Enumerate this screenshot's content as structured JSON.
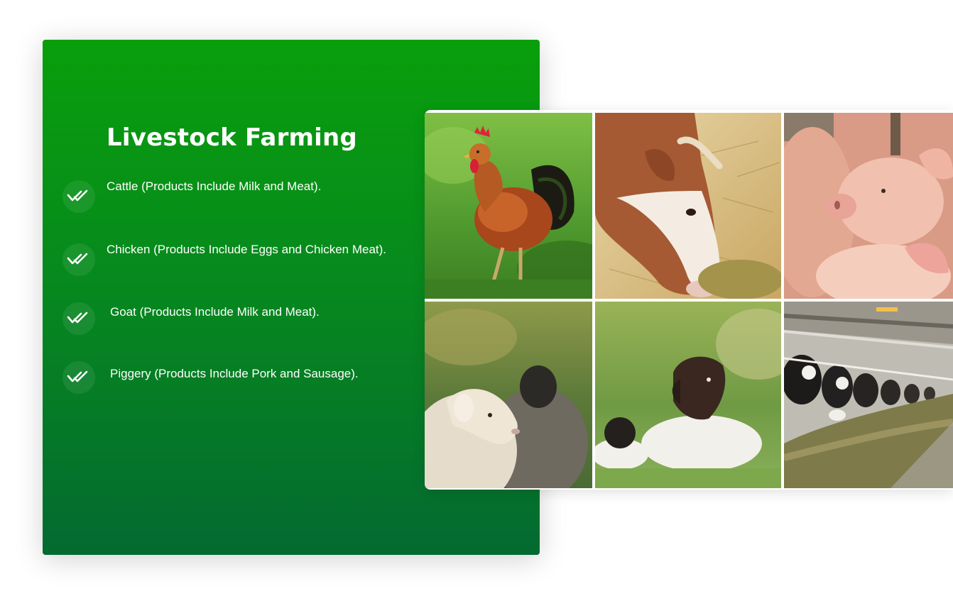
{
  "card": {
    "title": "Livestock Farming",
    "background_top": "#089f0b",
    "background_bottom": "#046a31"
  },
  "features": [
    {
      "icon": "double-check-icon",
      "text": "Cattle (Products Include Milk and Meat)."
    },
    {
      "icon": "double-check-icon",
      "text": "Chicken (Products Include Eggs and Chicken Meat)."
    },
    {
      "icon": "double-check-icon",
      "text": "Goat (Products Include Milk and Meat)."
    },
    {
      "icon": "double-check-icon",
      "text": "Piggery (Products Include Pork and Sausage)."
    }
  ],
  "gallery": {
    "photos": [
      {
        "subject": "rooster"
      },
      {
        "subject": "cow-eating-hay"
      },
      {
        "subject": "piglets"
      },
      {
        "subject": "sheep"
      },
      {
        "subject": "goats-lying"
      },
      {
        "subject": "dairy-cows-barn"
      }
    ]
  }
}
